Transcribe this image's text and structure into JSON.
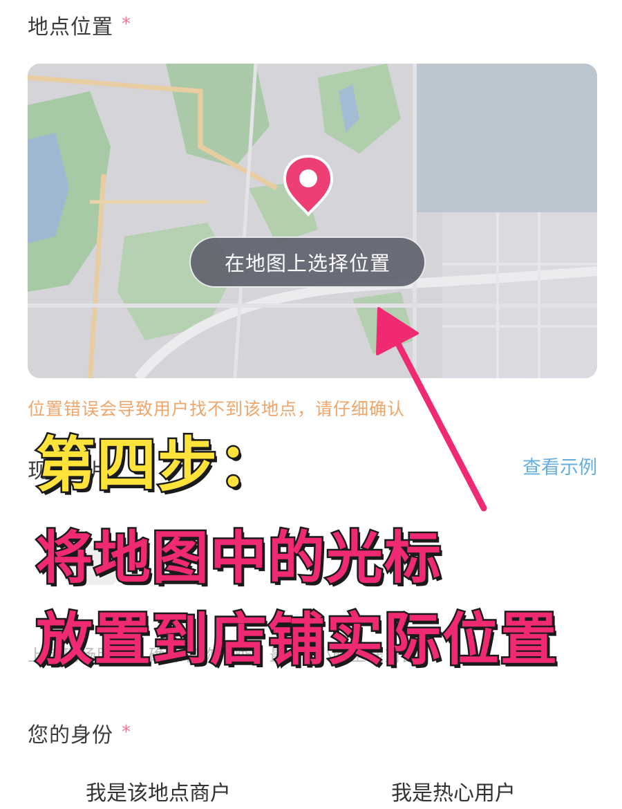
{
  "form": {
    "location_label": "地点位置",
    "required_mark": "*",
    "map_button_label": "在地图上选择位置",
    "warning_text": "位置错误会导致用户找不到该地点，请仔细确认",
    "photo_label": "现场照片",
    "view_example_label": "查看示例",
    "upload_hint": "上传现场照片，确保名称清晰，最多2小时上线对比",
    "identity_label": "您的身份",
    "identity_options": [
      "我是该地点商户",
      "我是热心用户"
    ]
  },
  "overlay": {
    "step_title": "第四步：",
    "line1": "将地图中的光标",
    "line2": "放置到店铺实际位置"
  },
  "colors": {
    "required": "#f0758e",
    "warning": "#f0a66a",
    "link": "#66aee0",
    "pin": "#ee3f74",
    "overlay_yellow": "#ffe23a",
    "overlay_pink": "#f02a72"
  },
  "icons": {
    "pin": "map-pin-icon",
    "arrow": "annotation-arrow"
  }
}
